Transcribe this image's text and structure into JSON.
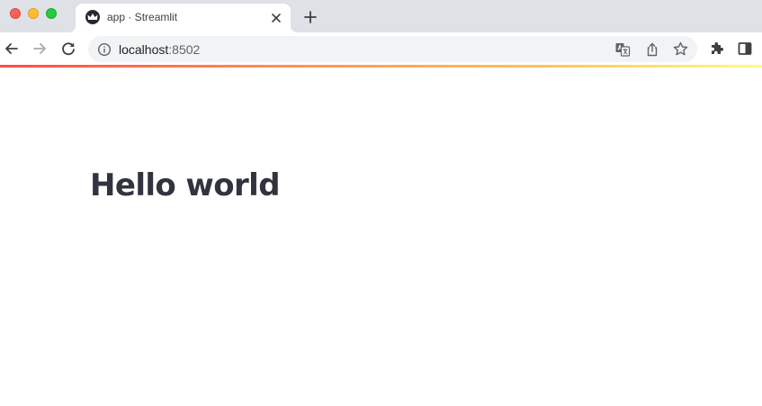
{
  "browser": {
    "tab": {
      "title": "app · Streamlit"
    },
    "address_bar": {
      "host": "localhost",
      "port": ":8502"
    }
  },
  "app": {
    "heading": "Hello world"
  },
  "colors": {
    "tabstrip": "#dee1e6",
    "omnibox": "#f1f3f4",
    "heading_text": "#31333f",
    "decoration_gradient": [
      "#ff4b4b",
      "#ff8c52",
      "#ffc95a",
      "#fffd80"
    ]
  },
  "icons": {
    "window_controls": [
      "close-window-icon",
      "minimize-window-icon",
      "maximize-window-icon"
    ],
    "tab": [
      "streamlit-crown-icon",
      "close-icon"
    ],
    "toolbar": [
      "back-arrow-icon",
      "forward-arrow-icon",
      "reload-icon",
      "info-icon",
      "translate-icon",
      "share-icon",
      "star-icon",
      "puzzle-icon",
      "side-panel-icon"
    ]
  }
}
